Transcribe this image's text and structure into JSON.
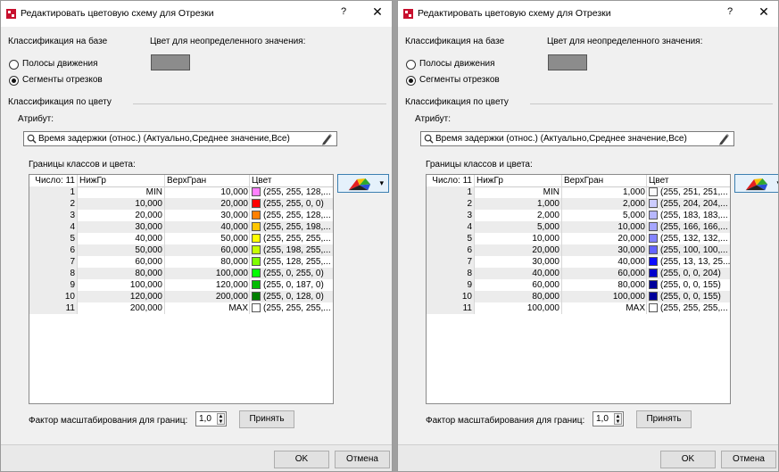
{
  "dialogs": [
    {
      "title": "Редактировать цветовую схему для Отрезки",
      "help": "?",
      "close": "✕",
      "classification_label": "Классификация на базе",
      "radio_lanes": "Полосы движения",
      "radio_segments": "Сегменты отрезков",
      "undef_color_label": "Цвет для неопределенного значения:",
      "color_class_group": "Классификация по цвету",
      "attribute_label": "Атрибут:",
      "attribute_value": "Время задержки (относ.) (Актуально,Среднее значение,Все)",
      "bounds_label": "Границы классов и цвета:",
      "table_headers": {
        "count": "Число: 11",
        "lower": "НижГр",
        "upper": "ВерхГран",
        "color": "Цвет"
      },
      "rows": [
        {
          "n": "1",
          "lower": "MIN",
          "upper": "10,000",
          "color": "#ff80ff",
          "rgb": "(255, 255, 128,..."
        },
        {
          "n": "2",
          "lower": "10,000",
          "upper": "20,000",
          "color": "#ff0000",
          "rgb": "(255, 255, 0, 0)"
        },
        {
          "n": "3",
          "lower": "20,000",
          "upper": "30,000",
          "color": "#ff8000",
          "rgb": "(255, 255, 128,..."
        },
        {
          "n": "4",
          "lower": "30,000",
          "upper": "40,000",
          "color": "#ffc600",
          "rgb": "(255, 255, 198,..."
        },
        {
          "n": "5",
          "lower": "40,000",
          "upper": "50,000",
          "color": "#ffff00",
          "rgb": "(255, 255, 255,..."
        },
        {
          "n": "6",
          "lower": "50,000",
          "upper": "60,000",
          "color": "#c6ff00",
          "rgb": "(255, 198, 255,..."
        },
        {
          "n": "7",
          "lower": "60,000",
          "upper": "80,000",
          "color": "#80ff00",
          "rgb": "(255, 128, 255,..."
        },
        {
          "n": "8",
          "lower": "80,000",
          "upper": "100,000",
          "color": "#00ff00",
          "rgb": "(255, 0, 255, 0)"
        },
        {
          "n": "9",
          "lower": "100,000",
          "upper": "120,000",
          "color": "#00bb00",
          "rgb": "(255, 0, 187, 0)"
        },
        {
          "n": "10",
          "lower": "120,000",
          "upper": "200,000",
          "color": "#008000",
          "rgb": "(255, 0, 128, 0)"
        },
        {
          "n": "11",
          "lower": "200,000",
          "upper": "MAX",
          "color": "#ffffff",
          "rgb": "(255, 255, 255,..."
        }
      ],
      "scale_label": "Фактор масштабирования для границ:",
      "scale_value": "1,0",
      "apply": "Принять",
      "ok": "OK",
      "cancel": "Отмена"
    },
    {
      "title": "Редактировать цветовую схему для Отрезки",
      "help": "?",
      "close": "✕",
      "classification_label": "Классификация на базе",
      "radio_lanes": "Полосы движения",
      "radio_segments": "Сегменты отрезков",
      "undef_color_label": "Цвет для неопределенного значения:",
      "color_class_group": "Классификация по цвету",
      "attribute_label": "Атрибут:",
      "attribute_value": "Время задержки (относ.) (Актуально,Среднее значение,Все)",
      "bounds_label": "Границы классов и цвета:",
      "table_headers": {
        "count": "Число: 11",
        "lower": "НижГр",
        "upper": "ВерхГран",
        "color": "Цвет"
      },
      "rows": [
        {
          "n": "1",
          "lower": "MIN",
          "upper": "1,000",
          "color": "#fbfbfb",
          "rgb": "(255, 251, 251,..."
        },
        {
          "n": "2",
          "lower": "1,000",
          "upper": "2,000",
          "color": "#ccccff",
          "rgb": "(255, 204, 204,..."
        },
        {
          "n": "3",
          "lower": "2,000",
          "upper": "5,000",
          "color": "#b7b7ff",
          "rgb": "(255, 183, 183,..."
        },
        {
          "n": "4",
          "lower": "5,000",
          "upper": "10,000",
          "color": "#a6a6ff",
          "rgb": "(255, 166, 166,..."
        },
        {
          "n": "5",
          "lower": "10,000",
          "upper": "20,000",
          "color": "#8484ff",
          "rgb": "(255, 132, 132,..."
        },
        {
          "n": "6",
          "lower": "20,000",
          "upper": "30,000",
          "color": "#6464ff",
          "rgb": "(255, 100, 100,..."
        },
        {
          "n": "7",
          "lower": "30,000",
          "upper": "40,000",
          "color": "#0d0dff",
          "rgb": "(255, 13, 13, 25..."
        },
        {
          "n": "8",
          "lower": "40,000",
          "upper": "60,000",
          "color": "#0000cc",
          "rgb": "(255, 0, 0, 204)"
        },
        {
          "n": "9",
          "lower": "60,000",
          "upper": "80,000",
          "color": "#00009b",
          "rgb": "(255, 0, 0, 155)"
        },
        {
          "n": "10",
          "lower": "80,000",
          "upper": "100,000",
          "color": "#00009b",
          "rgb": "(255, 0, 0, 155)"
        },
        {
          "n": "11",
          "lower": "100,000",
          "upper": "MAX",
          "color": "#ffffff",
          "rgb": "(255, 255, 255,..."
        }
      ],
      "scale_label": "Фактор масштабирования для границ:",
      "scale_value": "1,0",
      "apply": "Принять",
      "ok": "OK",
      "cancel": "Отмена"
    }
  ]
}
